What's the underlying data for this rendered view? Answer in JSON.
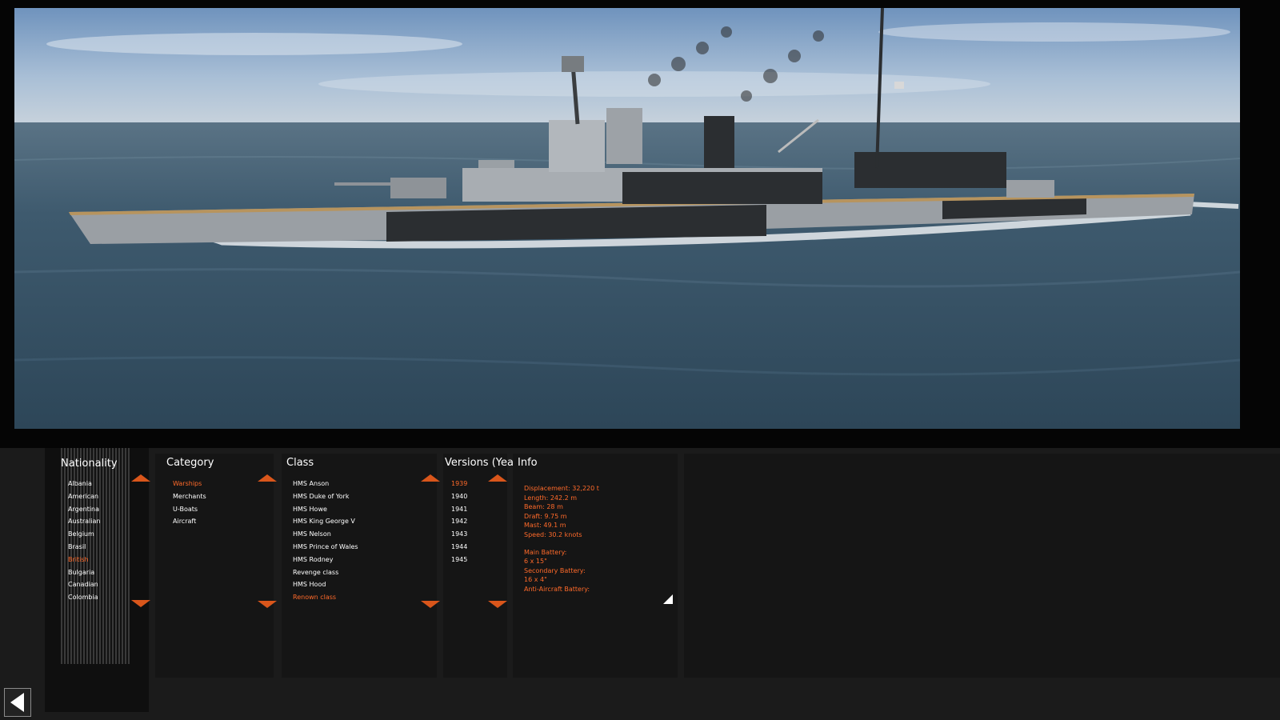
{
  "nationality": {
    "header": "Nationality",
    "items": [
      "Albania",
      "American",
      "Argentina",
      "Australian",
      "Belgium",
      "Brasil",
      "British",
      "Bulgaria",
      "Canadian",
      "Colombia"
    ],
    "selected": "British"
  },
  "category": {
    "header": "Category",
    "items": [
      "Warships",
      "Merchants",
      "U-Boats",
      "Aircraft"
    ],
    "selected": "Warships"
  },
  "class": {
    "header": "Class",
    "items": [
      "HMS Anson",
      "HMS Duke of York",
      "HMS Howe",
      "HMS King George V",
      "HMS Nelson",
      "HMS Prince of Wales",
      "HMS Rodney",
      "Revenge class",
      "HMS Hood",
      "Renown class"
    ],
    "selected": "Renown class"
  },
  "versions": {
    "header": "Versions (Year)",
    "items": [
      "1939",
      "1940",
      "1941",
      "1942",
      "1943",
      "1944",
      "1945"
    ],
    "selected": "1939"
  },
  "info": {
    "header": "Info",
    "lines_top": [
      "Displacement: 32,220 t",
      "Length: 242.2 m",
      "Beam: 28 m",
      "Draft: 9.75 m",
      "Mast: 49.1 m",
      "Speed: 30.2 knots"
    ],
    "lines_bottom": [
      "Main Battery:",
      "6 x 15\"",
      "Secondary Battery:",
      "16 x 4\"",
      "Anti-Aircraft Battery:"
    ]
  },
  "colors": {
    "accent": "#ff6a2a",
    "arrow": "#d9561b",
    "panel": "#151515",
    "background": "#1b1b1b"
  },
  "icons": {
    "back": "back-arrow-icon",
    "scroll_up": "triangle-up-icon",
    "scroll_down": "triangle-down-icon",
    "expand": "corner-expand-icon"
  }
}
